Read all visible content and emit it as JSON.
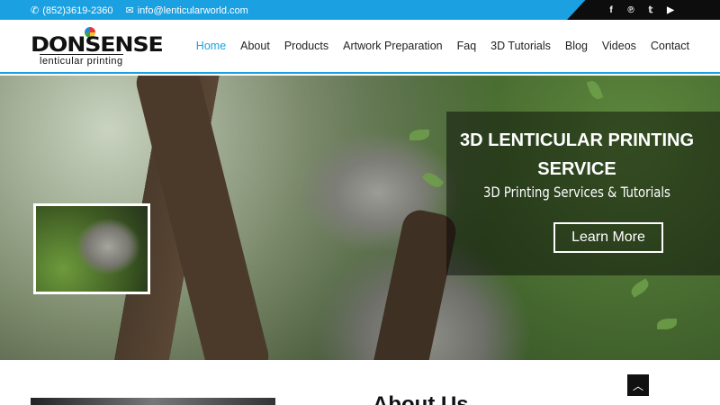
{
  "topbar": {
    "phone": "(852)3619-2360",
    "email": "info@lenticularworld.com",
    "social": [
      {
        "icon": "facebook-icon",
        "glyph": "f"
      },
      {
        "icon": "pinterest-icon",
        "glyph": "℗"
      },
      {
        "icon": "twitter-icon",
        "glyph": "𝕥"
      },
      {
        "icon": "youtube-icon",
        "glyph": "▶"
      }
    ]
  },
  "logo": {
    "brand": "DONSENSE",
    "tagline": "lenticular printing"
  },
  "nav": {
    "items": [
      "Home",
      "About",
      "Products",
      "Artwork Preparation",
      "Faq",
      "3D Tutorials",
      "Blog",
      "Videos",
      "Contact"
    ],
    "active": "Home"
  },
  "hero": {
    "headline": "3D LENTICULAR PRINTING SERVICE",
    "subheadline": "3D Printing Services & Tutorials",
    "cta": "Learn More"
  },
  "about": {
    "title": "About Us"
  },
  "colors": {
    "accent": "#1ba1e2",
    "dark": "#0d0d0d"
  }
}
